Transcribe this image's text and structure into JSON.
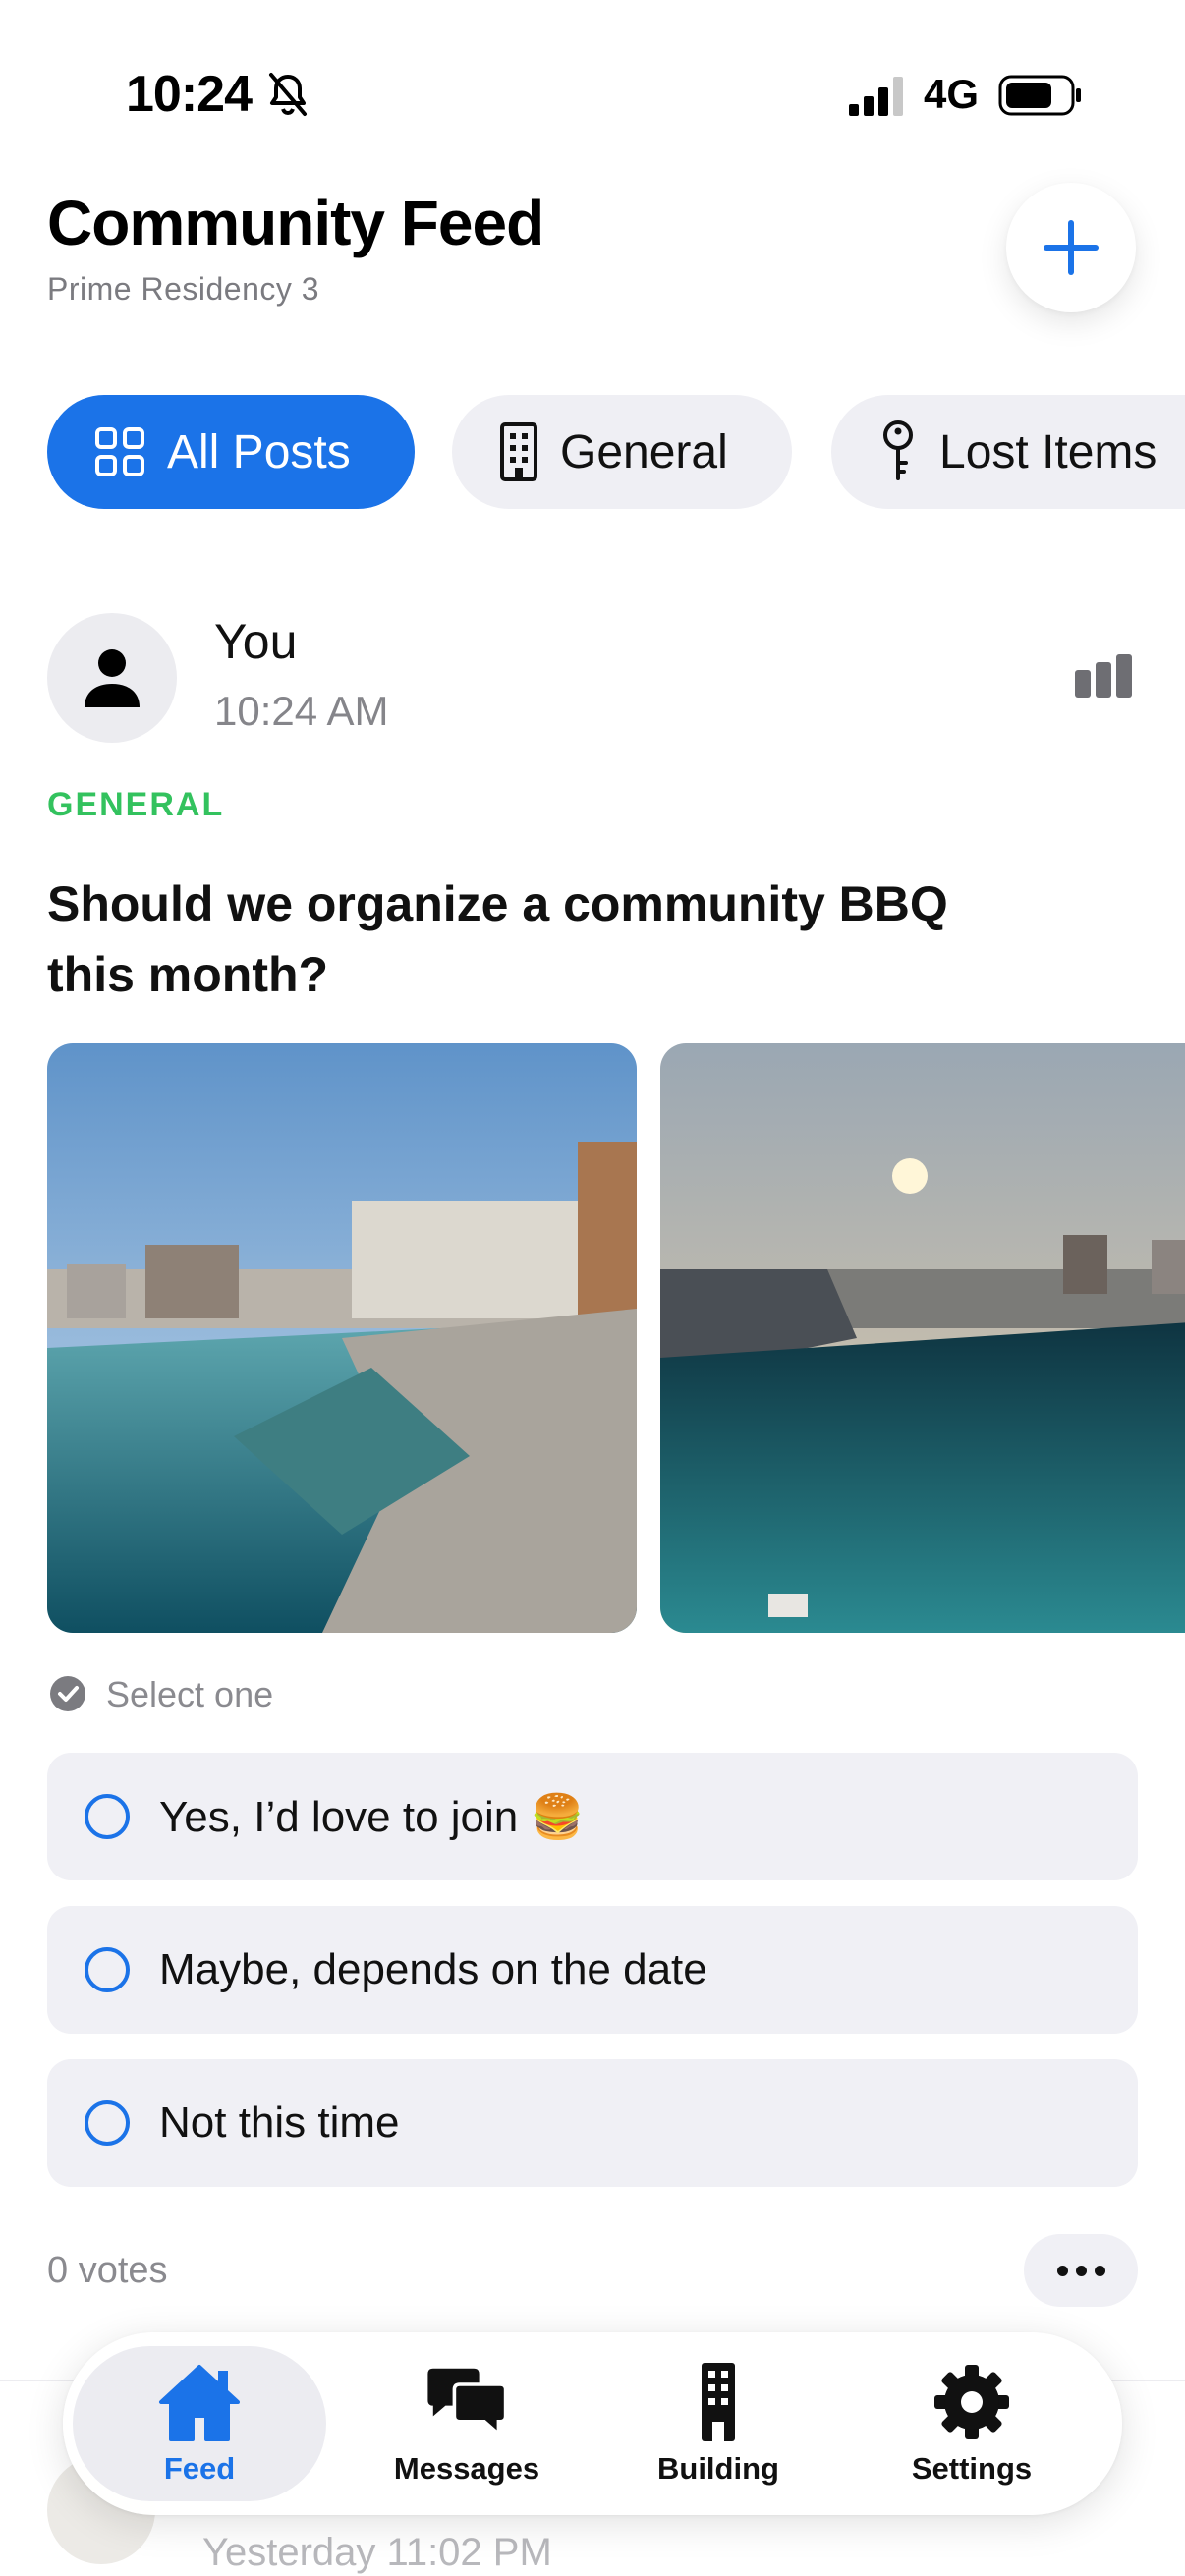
{
  "status_bar": {
    "time": "10:24",
    "network": "4G"
  },
  "header": {
    "title": "Community Feed",
    "subtitle": "Prime Residency 3"
  },
  "filters": [
    {
      "label": "All Posts",
      "icon": "grid-icon",
      "active": true
    },
    {
      "label": "General",
      "icon": "building-icon",
      "active": false
    },
    {
      "label": "Lost Items",
      "icon": "key-icon",
      "active": false
    }
  ],
  "post": {
    "author": "You",
    "time": "10:24 AM",
    "category": "GENERAL",
    "question": "Should we organize a community BBQ this month?",
    "images": [
      "rooftop-pool-photo",
      "rooftop-pool-sunset-photo"
    ],
    "poll_hint": "Select one",
    "options": [
      "Yes, I’d love to join 🍔",
      "Maybe, depends on the date",
      "Not this time"
    ],
    "votes": "0 votes"
  },
  "next_post": {
    "time": "Yesterday 11:02 PM"
  },
  "tab_bar": {
    "tabs": [
      {
        "label": "Feed",
        "icon": "home-icon",
        "active": true
      },
      {
        "label": "Messages",
        "icon": "chat-bubbles-icon",
        "active": false
      },
      {
        "label": "Building",
        "icon": "building-icon",
        "active": false
      },
      {
        "label": "Settings",
        "icon": "gear-icon",
        "active": false
      }
    ]
  },
  "colors": {
    "accent": "#1b73e8",
    "category": "#33c25e",
    "chip_bg": "#efeff4"
  }
}
